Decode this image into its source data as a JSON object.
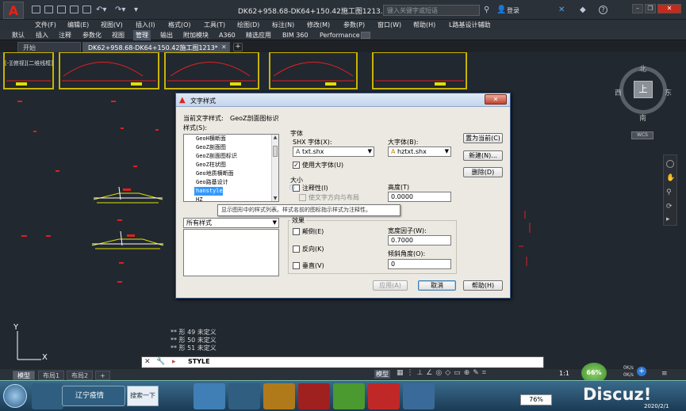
{
  "app": {
    "window_title": "DK62+958.68-DK64+150.42施工图1213.dwg",
    "search_placeholder": "键入关键字或短语",
    "login_label": "登录",
    "logo_letter": "A"
  },
  "menu": [
    "文件(F)",
    "编辑(E)",
    "视图(V)",
    "插入(I)",
    "格式(O)",
    "工具(T)",
    "绘图(D)",
    "标注(N)",
    "修改(M)",
    "参数(P)",
    "窗口(W)",
    "帮助(H)",
    "L路基设计辅助"
  ],
  "ribbon_tabs": [
    "默认",
    "插入",
    "注释",
    "参数化",
    "视图",
    "管理",
    "输出",
    "附加模块",
    "A360",
    "精选应用",
    "BIM 360",
    "Performance"
  ],
  "ribbon_active": "管理",
  "doc_tabs": [
    "开始",
    "DK62+958.68-DK64+150.42施工图1213*"
  ],
  "doc_tab_add": "+",
  "viewport_label": "[-][俯视][二维线框]",
  "viewcube": {
    "north": "北",
    "south": "南",
    "east": "东",
    "west": "西",
    "top": "上",
    "wcs": "WCS"
  },
  "ucs": {
    "x": "X",
    "y": "Y"
  },
  "command_history": [
    "** 形 49 未定义",
    "** 形 50 未定义",
    "** 形 51 未定义"
  ],
  "command_input": "STYLE",
  "layout_tabs": [
    "模型",
    "布局1",
    "布局2",
    "+"
  ],
  "status": {
    "model": "模型",
    "scale": "1:1",
    "progress_percent": "66%",
    "upload": "0K/s",
    "download": "0K/s"
  },
  "taskbar": {
    "app1": "辽宁疫情",
    "app2": "搜索一下",
    "battery": "76%",
    "time": "",
    "date": "2020/2/1",
    "watermark": "Discuz!"
  },
  "dialog": {
    "title": "文字样式",
    "current_style_label": "当前文字样式:",
    "current_style_value": "GeoZ剖面图标识",
    "styles_label": "样式(S):",
    "styles": [
      "GeoH横断面",
      "GeoZ剖面图",
      "GeoZ剖面图标识",
      "GeoZ柱状图",
      "Geo地质横断面",
      "Geo路基设计",
      "hanstyle",
      "HZ"
    ],
    "selected_style": "hanstyle",
    "filter_value": "所有样式",
    "font_group": "字体",
    "shx_font_label": "SHX 字体(X):",
    "shx_font_value": "txt.shx",
    "big_font_label": "大字体(B):",
    "big_font_value": "hztxt.shx",
    "use_big_font_label": "使用大字体(U)",
    "size_group": "大小",
    "annotative_label": "注释性(I)",
    "match_layout_label": "使文字方向与布局",
    "height_label": "高度(T)",
    "height_value": "0.0000",
    "effects_group": "效果",
    "upside_down_label": "颠倒(E)",
    "backwards_label": "反向(K)",
    "vertical_label": "垂直(V)",
    "width_factor_label": "宽度因子(W):",
    "width_factor_value": "0.7000",
    "oblique_label": "倾斜角度(O):",
    "oblique_value": "0",
    "set_current_btn": "置为当前(C)",
    "new_btn": "新建(N)...",
    "delete_btn": "删除(D)",
    "apply_btn": "应用(A)",
    "cancel_btn": "取消",
    "help_btn": "帮助(H)",
    "tooltip": "显示图形中的样式列表。样式名前的图标指示样式为注释性。"
  },
  "colors": {
    "titlebar": "#2b3139",
    "canvas": "#212830",
    "drawing_red": "#e02020",
    "drawing_yellow": "#c8b400",
    "dialog_bg": "#ece9e2",
    "selection": "#3399ff"
  }
}
